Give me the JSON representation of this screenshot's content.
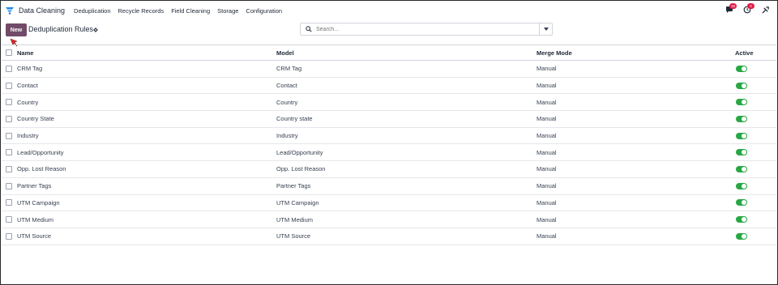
{
  "navbar": {
    "app_name": "Data Cleaning",
    "menu": [
      "Deduplication",
      "Recycle Records",
      "Field Cleaning",
      "Storage",
      "Configuration"
    ],
    "messages_badge": "15",
    "activity_badge": "4"
  },
  "control": {
    "new_label": "New",
    "title": "Deduplication Rules",
    "search_placeholder": "Search..."
  },
  "table": {
    "headers": {
      "name": "Name",
      "model": "Model",
      "merge_mode": "Merge Mode",
      "active": "Active"
    },
    "rows": [
      {
        "name": "CRM Tag",
        "model": "CRM Tag",
        "merge_mode": "Manual",
        "active": true
      },
      {
        "name": "Contact",
        "model": "Contact",
        "merge_mode": "Manual",
        "active": true
      },
      {
        "name": "Country",
        "model": "Country",
        "merge_mode": "Manual",
        "active": true
      },
      {
        "name": "Country State",
        "model": "Country state",
        "merge_mode": "Manual",
        "active": true
      },
      {
        "name": "Industry",
        "model": "Industry",
        "merge_mode": "Manual",
        "active": true
      },
      {
        "name": "Lead/Opportunity",
        "model": "Lead/Opportunity",
        "merge_mode": "Manual",
        "active": true
      },
      {
        "name": "Opp. Lost Reason",
        "model": "Opp. Lost Reason",
        "merge_mode": "Manual",
        "active": true
      },
      {
        "name": "Partner Tags",
        "model": "Partner Tags",
        "merge_mode": "Manual",
        "active": true
      },
      {
        "name": "UTM Campaign",
        "model": "UTM Campaign",
        "merge_mode": "Manual",
        "active": true
      },
      {
        "name": "UTM Medium",
        "model": "UTM Medium",
        "merge_mode": "Manual",
        "active": true
      },
      {
        "name": "UTM Source",
        "model": "UTM Source",
        "merge_mode": "Manual",
        "active": true
      }
    ]
  },
  "colors": {
    "primary": "#714b67",
    "toggle_on": "#28a745",
    "badge": "#e11d48",
    "pointer": "#dc2626"
  }
}
